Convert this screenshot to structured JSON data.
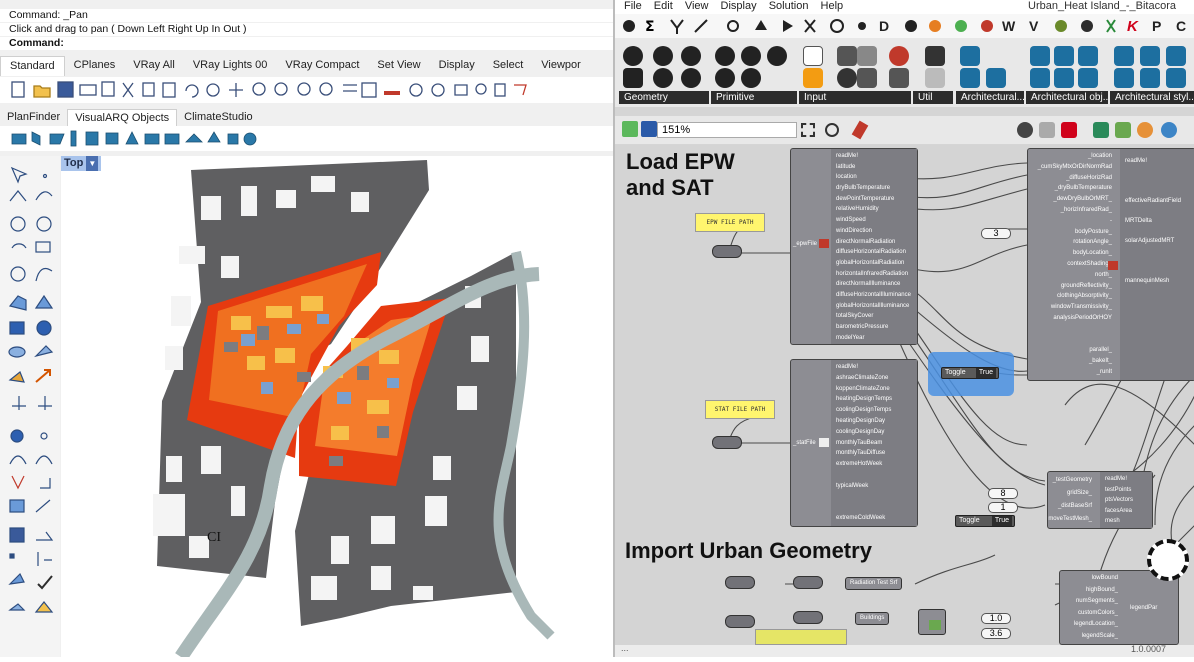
{
  "rhino": {
    "command_lines": [
      "Command: _Pan",
      "Click and drag to pan ( Down  Left  Right  Up  In  Out )",
      "Command:"
    ],
    "tabs": [
      "Standard",
      "CPlanes",
      "VRay All",
      "VRay Lights 00",
      "VRay Compact",
      "Set View",
      "Display",
      "Select",
      "Viewpor"
    ],
    "plugin_tabs": [
      "PlanFinder",
      "VisualARQ Objects",
      "ClimateStudio"
    ],
    "viewport_label": "Top",
    "viewport_annotation": "CI"
  },
  "grasshopper": {
    "menu": [
      "File",
      "Edit",
      "View",
      "Display",
      "Solution",
      "Help"
    ],
    "doc_title": "Urban_Heat Island_-_Bitacora",
    "category_letters": [
      "D",
      "W",
      "V",
      "K",
      "P",
      "C"
    ],
    "groups": [
      "Geometry",
      "Primitive",
      "Input",
      "Util",
      "Architectural...",
      "Architectural obj..",
      "Architectural styl.."
    ],
    "zoom": "151%",
    "labels": {
      "load": "Load EPW\nand SAT",
      "import": "Import Urban Geometry"
    },
    "panels": {
      "epw": "EPW FILE PATH",
      "stat": "STAT FILE PATH"
    },
    "epw_component": {
      "input": "_epwFile",
      "outputs": [
        "readMe!",
        "latitude",
        "location",
        "dryBulbTemperature",
        "dewPointTemperature",
        "relativeHumidity",
        "windSpeed",
        "windDirection",
        "directNormalRadiation",
        "diffuseHorizontalRadiation",
        "globalHorizontalRadiation",
        "horizontalInfraredRadiation",
        "directNormalIlluminance",
        "diffuseHorizontalIlluminance",
        "globalHorizontalIlluminance",
        "totalSkyCover",
        "barometricPressure",
        "modelYear"
      ]
    },
    "stat_component": {
      "input": "_statFile",
      "outputs": [
        "readMe!",
        "ashraeClimateZone",
        "koppenClimateZone",
        "heatingDesignTemps",
        "coolingDesignTemps",
        "heatingDesignDay",
        "coolingDesignDay",
        "monthlyTauBeam",
        "monthlyTauDiffuse",
        "extremeHotWeek",
        "",
        "typicalWeek",
        "",
        "",
        "extremeColdWeek"
      ]
    },
    "mrt_component": {
      "inputs": [
        "_location",
        "_cumSkyMtxOrDirNormRad",
        "_diffuseHorizRad",
        "_dryBulbTemperature",
        "_dewDryBulbOrMRT_",
        "_horizInfraredRad_",
        "-",
        "bodyPosture_",
        "rotationAngle_",
        "bodyLocation_",
        "contextShading_",
        "north_",
        "groundReflectivity_",
        "clothingAbsorptivity_",
        "windowTransmissivity_",
        "analysisPeriodOrHOY",
        "",
        "",
        "parallel_",
        "_bakeIt_",
        "_runIt"
      ],
      "outputs": [
        "readMe!",
        "",
        "effectiveRadiantField",
        "MRTDelta",
        "solarAdjustedMRT",
        "",
        "mannequinMesh"
      ]
    },
    "test_component": {
      "inputs": [
        "_testGeometry",
        "gridSize_",
        "_distBaseSrf",
        "moveTestMesh_"
      ],
      "outputs": [
        "readMe!",
        "testPoints",
        "ptsVectors",
        "facesArea",
        "mesh"
      ]
    },
    "legend_component": {
      "inputs": [
        "lowBound",
        "highBound_",
        "numSegments_",
        "customColors_",
        "legendLocation_",
        "legendScale_"
      ],
      "outputs": [
        "legendPar"
      ]
    },
    "values": {
      "number_3": "3",
      "number_8": "8",
      "number_1": "1",
      "number_10": "1.0",
      "number_36": "3.6",
      "toggle_label": "Toggle",
      "toggle_value": "True",
      "radiation_label": "Radiation Test Srf",
      "buildings_label": "Buildings"
    },
    "status_version": "1.0.0007",
    "status_left": "..."
  }
}
